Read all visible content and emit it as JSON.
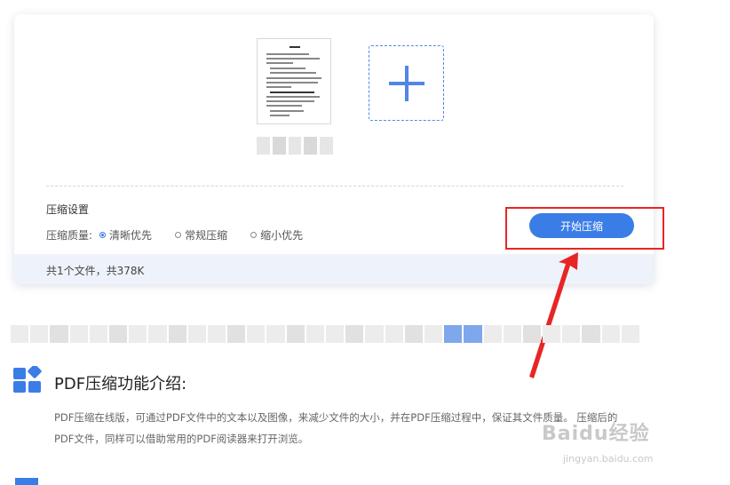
{
  "upload": {
    "thumbnail_icon": "document-thumbnail",
    "add_icon": "plus-icon"
  },
  "settings": {
    "title": "压缩设置",
    "quality_label": "压缩质量:",
    "options": [
      "清晰优先",
      "常规压缩",
      "缩小优先"
    ],
    "selected": "清晰优先",
    "start_button": "开始压缩"
  },
  "summary": "共1个文件，共378K",
  "intro": {
    "title": "PDF压缩功能介绍:",
    "icon": "apps-grid-icon",
    "text_line1": "PDF压缩在线版，可通过PDF文件中的文本以及图像，来减少文件的大小，并在PDF压缩过程中，保证其文件质量。 压缩后的",
    "text_line2": "PDF文件，同样可以借助常用的PDF阅读器来打开浏览。"
  },
  "watermark": {
    "main": "Baidu经验",
    "sub": "jingyan.baidu.com"
  },
  "colors": {
    "accent": "#3b7de6",
    "annotation": "#e82525",
    "footer_bg": "#eef3fb"
  }
}
